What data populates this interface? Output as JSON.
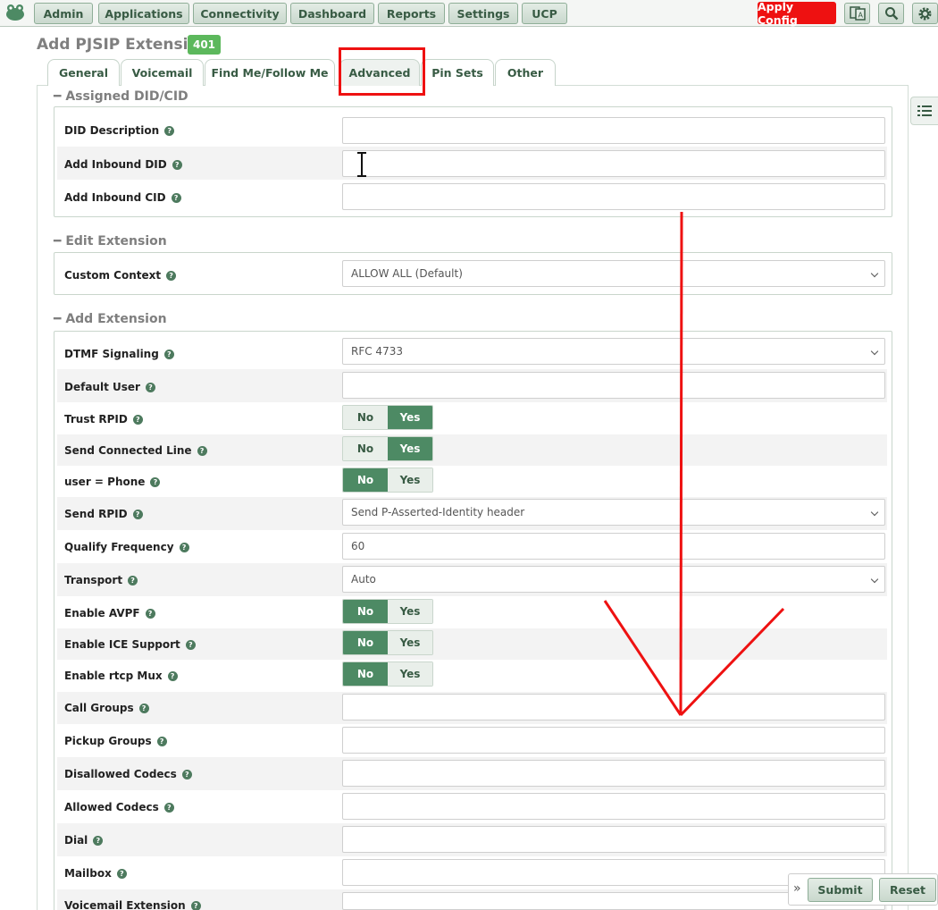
{
  "nav": {
    "items": [
      "Admin",
      "Applications",
      "Connectivity",
      "Dashboard",
      "Reports",
      "Settings",
      "UCP"
    ],
    "apply_label": "Apply Config"
  },
  "page": {
    "title": "Add PJSIP Extension",
    "badge": "401"
  },
  "tabs": [
    "General",
    "Voicemail",
    "Find Me/Follow Me",
    "Advanced",
    "Pin Sets",
    "Other"
  ],
  "active_tab": "Advanced",
  "sections": {
    "assigned": {
      "title": "Assigned DID/CID",
      "rows": [
        {
          "label": "DID Description",
          "value": ""
        },
        {
          "label": "Add Inbound DID",
          "value": ""
        },
        {
          "label": "Add Inbound CID",
          "value": ""
        }
      ]
    },
    "edit": {
      "title": "Edit Extension",
      "rows": [
        {
          "label": "Custom Context",
          "value": "ALLOW ALL (Default)"
        }
      ]
    },
    "add": {
      "title": "Add Extension",
      "rows": [
        {
          "label": "DTMF Signaling",
          "value": "RFC 4733"
        },
        {
          "label": "Default User",
          "value": ""
        },
        {
          "label": "Trust RPID",
          "no": "No",
          "yes": "Yes",
          "selected": "Yes"
        },
        {
          "label": "Send Connected Line",
          "no": "No",
          "yes": "Yes",
          "selected": "Yes"
        },
        {
          "label": "user = Phone",
          "no": "No",
          "yes": "Yes",
          "selected": "No"
        },
        {
          "label": "Send RPID",
          "value": "Send P-Asserted-Identity header"
        },
        {
          "label": "Qualify Frequency",
          "value": "60"
        },
        {
          "label": "Transport",
          "value": "Auto"
        },
        {
          "label": "Enable AVPF",
          "no": "No",
          "yes": "Yes",
          "selected": "No"
        },
        {
          "label": "Enable ICE Support",
          "no": "No",
          "yes": "Yes",
          "selected": "No"
        },
        {
          "label": "Enable rtcp Mux",
          "no": "No",
          "yes": "Yes",
          "selected": "No"
        },
        {
          "label": "Call Groups",
          "value": ""
        },
        {
          "label": "Pickup Groups",
          "value": ""
        },
        {
          "label": "Disallowed Codecs",
          "value": ""
        },
        {
          "label": "Allowed Codecs",
          "value": ""
        },
        {
          "label": "Dial",
          "value": ""
        },
        {
          "label": "Mailbox",
          "value": ""
        },
        {
          "label": "Voicemail Extension",
          "value": ""
        }
      ]
    }
  },
  "footer": {
    "submit": "Submit",
    "reset": "Reset"
  },
  "colors": {
    "accent": "#4d8a64",
    "apply": "#ee1111",
    "annotation": "#ee1111"
  }
}
